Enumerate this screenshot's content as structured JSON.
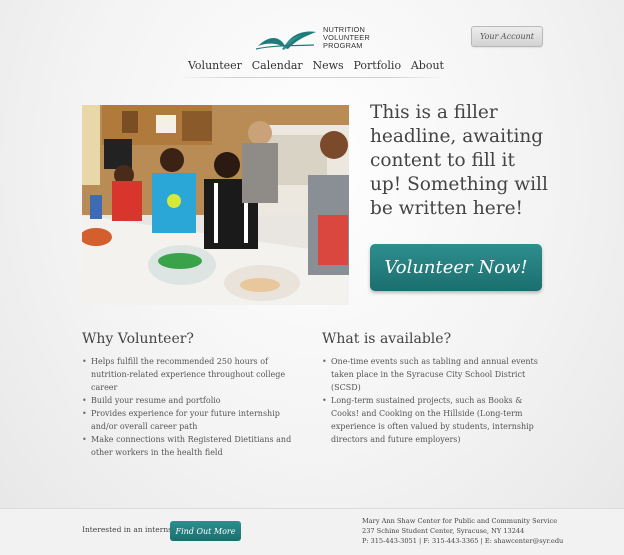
{
  "header": {
    "logo_lines": [
      "NUTRITION",
      "VOLUNTEER",
      "PROGRAM"
    ],
    "account_label": "Your Account"
  },
  "nav": {
    "items": [
      "Volunteer",
      "Calendar",
      "News",
      "Portfolio",
      "About"
    ]
  },
  "hero": {
    "headline": "This is a filler headline, awaiting content to fill it up! Something will be written here!",
    "cta_label": "Volunteer Now!"
  },
  "why": {
    "title": "Why Volunteer?",
    "items": [
      "Helps fulfill the recommended 250 hours of nutrition-related experience throughout college career",
      "Build your resume and portfolio",
      "Provides experience for your future internship and/or overall career path",
      "Make connections with Registered Dietitians and other workers in the health field"
    ]
  },
  "available": {
    "title": "What is available?",
    "items": [
      "One-time events such as tabling and annual events taken place in the Syracuse City School District (SCSD)",
      "Long-term sustained projects, such as Books & Cooks! and Cooking on the Hillside (Long-term experience is often valued by students, internship directors and future employers)"
    ]
  },
  "footer": {
    "internship_question": "Interested in an internship?",
    "find_label": "Find Out More",
    "contact_name": "Mary Ann Shaw Center for Public and Community Service",
    "contact_address": "237 Schine Student Center, Syracuse, NY 13244",
    "contact_phone": "P: 315-443-3051 | F: 315-443-3365 | E: shawcenter@syr.edu"
  },
  "colors": {
    "accent": "#1f7a7a",
    "background": "#f0f0f0"
  }
}
